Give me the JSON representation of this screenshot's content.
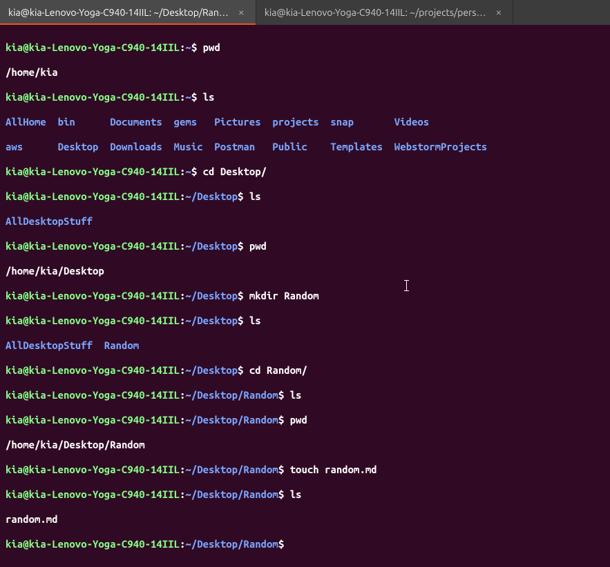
{
  "tabs": [
    {
      "title": "kia@kia-Lenovo-Yoga-C940-14IIL: ~/Desktop/Ran…",
      "active": true
    },
    {
      "title": "kia@kia-Lenovo-Yoga-C940-14IIL: ~/projects/pers…",
      "active": false
    }
  ],
  "colors": {
    "bg": "#300a24",
    "promptUser": "#87ff87",
    "promptPath": "#7aa6ff",
    "accent": "#e95420"
  },
  "prompt": {
    "userhost": "kia@kia-Lenovo-Yoga-C940-14IIL",
    "home": "~",
    "desktop": "~/Desktop",
    "random": "~/Desktop/Random"
  },
  "commands": {
    "pwd": "pwd",
    "ls": "ls",
    "cdDesktop": "cd Desktop/",
    "mkdir": "mkdir Random",
    "cdRandom": "cd Random/",
    "touch": "touch random.md"
  },
  "outputs": {
    "pwdHome": "/home/kia",
    "lsHomeRow1": "AllHome  bin      Documents  gems   Pictures  projects  snap       Videos",
    "lsHomeRow2": "aws      Desktop  Downloads  Music  Postman   Public    Templates  WebstormProjects",
    "lsDesktop1": "AllDesktopStuff",
    "pwdDesktop": "/home/kia/Desktop",
    "lsDesktop2": "AllDesktopStuff  Random",
    "pwdRandom": "/home/kia/Desktop/Random",
    "lsRandom": "random.md"
  }
}
